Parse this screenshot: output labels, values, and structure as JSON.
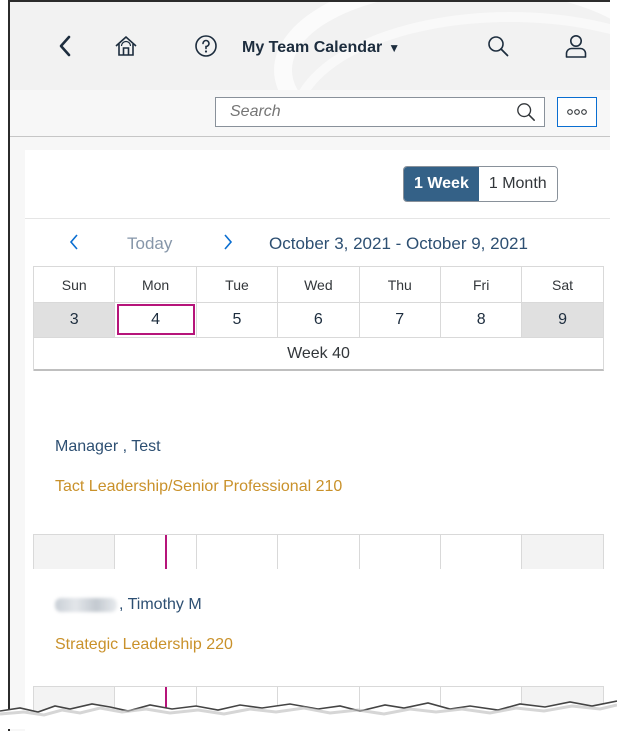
{
  "shell": {
    "title": "My Team Calendar",
    "icons": [
      "back-icon",
      "home-icon",
      "help-icon",
      "title-caret-icon",
      "search-icon",
      "user-icon"
    ]
  },
  "search": {
    "placeholder": "Search",
    "value": ""
  },
  "view_toggle": {
    "week_label": "1 Week",
    "month_label": "1 Month",
    "selected": "1 Week"
  },
  "nav": {
    "today_label": "Today",
    "range_label": "October 3, 2021 - October 9, 2021"
  },
  "days": [
    {
      "name": "Sun",
      "num": "3"
    },
    {
      "name": "Mon",
      "num": "4"
    },
    {
      "name": "Tue",
      "num": "5"
    },
    {
      "name": "Wed",
      "num": "6"
    },
    {
      "name": "Thu",
      "num": "7"
    },
    {
      "name": "Fri",
      "num": "8"
    },
    {
      "name": "Sat",
      "num": "9"
    }
  ],
  "selected_day": "4",
  "week_label": "Week 40",
  "employees": [
    {
      "name": "Manager , Test",
      "role": "Tact Leadership/Senior Professional 210"
    },
    {
      "name": ", Timothy M",
      "role": "Strategic Leadership 220"
    }
  ],
  "colors": {
    "accent": "#346187",
    "link": "#0a6ed1",
    "role": "#c9912a",
    "today_marker": "#b6147a",
    "weekend": "#e0e0e0"
  }
}
